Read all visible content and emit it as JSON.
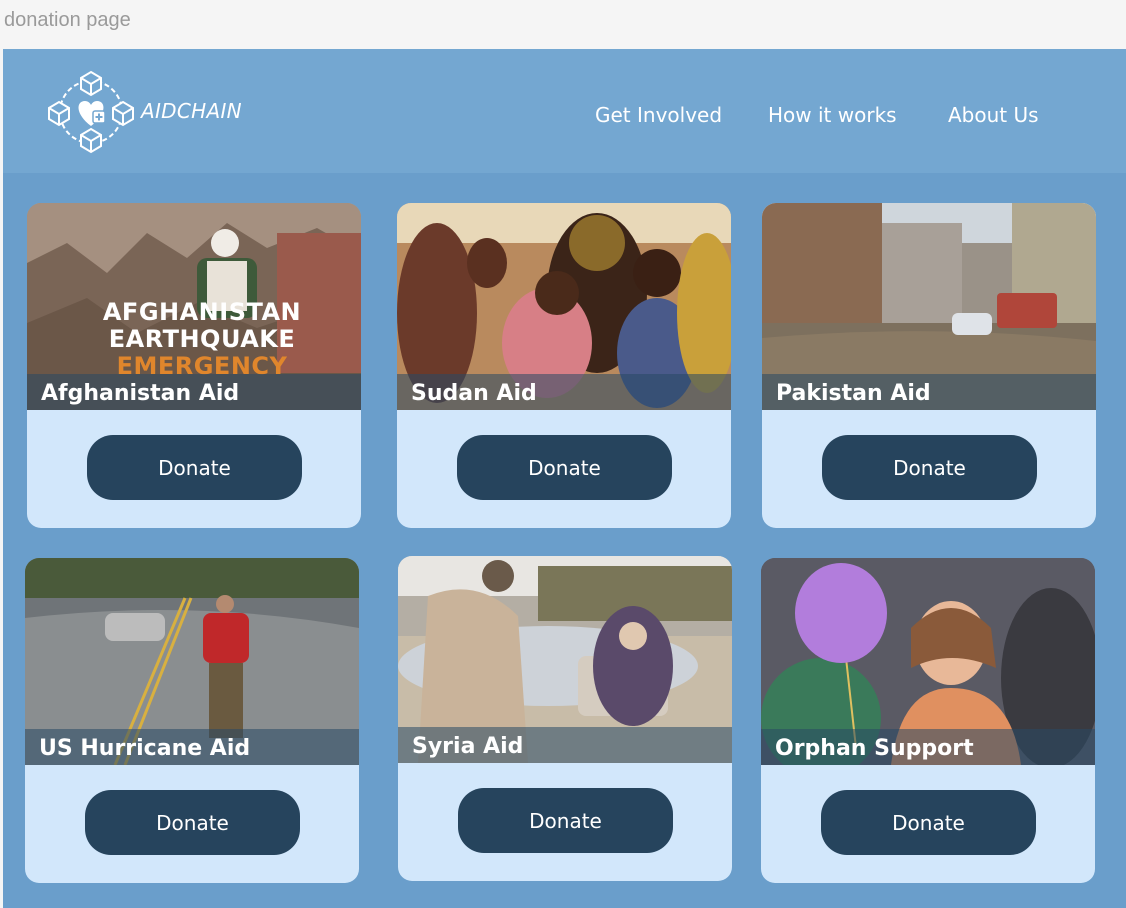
{
  "frame_label": "donation page",
  "header": {
    "brand": "AIDCHAIN",
    "logo_icon": "heart-plus-blockchain-icon",
    "nav": [
      {
        "label": "Get Involved"
      },
      {
        "label": "How it works"
      },
      {
        "label": "About Us"
      }
    ]
  },
  "cards": [
    {
      "title": "Afghanistan Aid",
      "button": "Donate",
      "poster": [
        "AFGHANISTAN",
        "EARTHQUAKE",
        "EMERGENCY"
      ]
    },
    {
      "title": "Sudan Aid",
      "button": "Donate"
    },
    {
      "title": "Pakistan Aid",
      "button": "Donate"
    },
    {
      "title": "US Hurricane Aid",
      "button": "Donate"
    },
    {
      "title": "Syria Aid",
      "button": "Donate"
    },
    {
      "title": "Orphan Support",
      "button": "Donate"
    }
  ],
  "colors": {
    "page_background": "#6a9ecb",
    "header_background": "#74a7d1",
    "card_background": "#d2e7fb",
    "button_background": "#26445d",
    "poster_accent": "#e0862c"
  }
}
